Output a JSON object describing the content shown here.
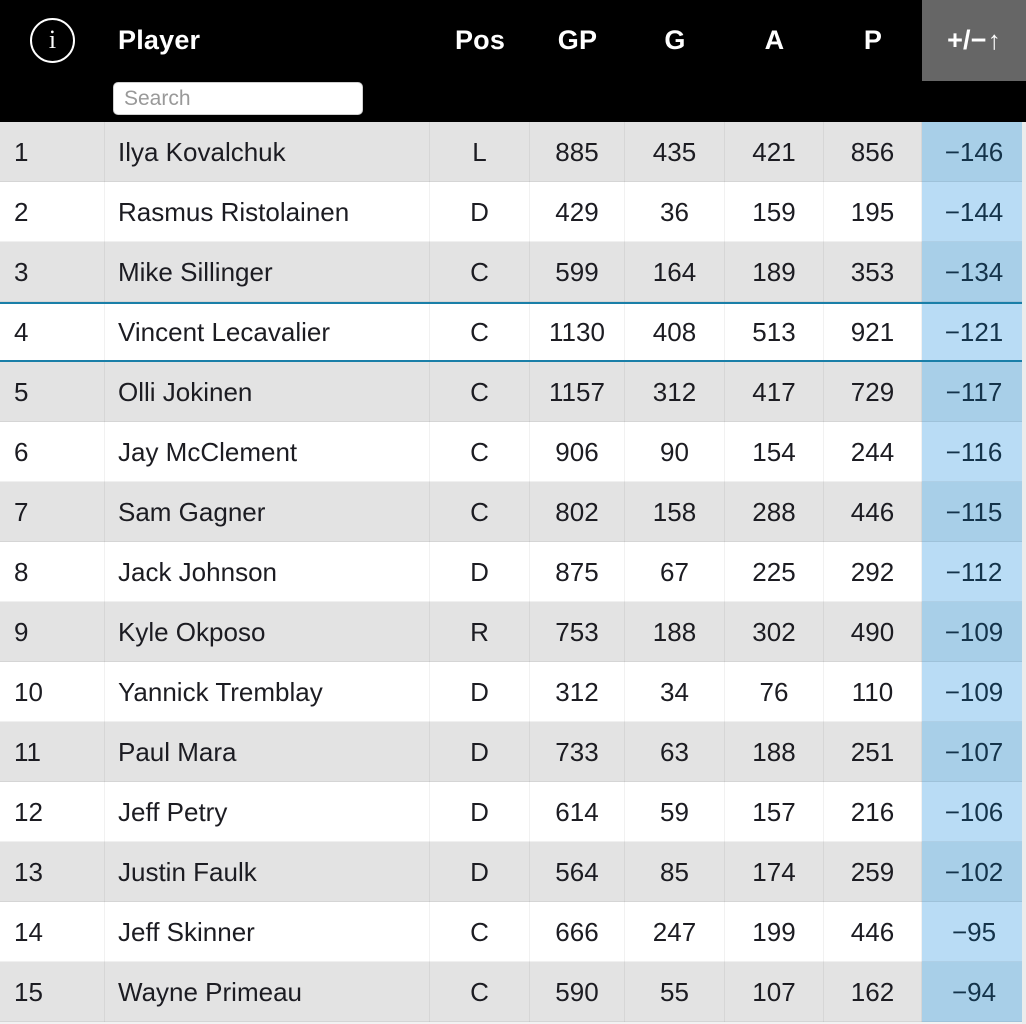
{
  "header": {
    "info_icon": "info-circle-icon",
    "info_glyph": "i",
    "columns": {
      "rank": "",
      "player": "Player",
      "pos": "Pos",
      "gp": "GP",
      "g": "G",
      "a": "A",
      "p": "P",
      "plusminus": "+/−",
      "sort_arrow": "↑"
    },
    "sorted_column": "plusminus",
    "sort_direction": "ascending"
  },
  "search": {
    "value": "",
    "placeholder": "Search"
  },
  "colors": {
    "header_bg": "#000000",
    "sorted_header_bg": "#666666",
    "row_odd_bg": "#e3e3e3",
    "row_even_bg": "#ffffff",
    "plusminus_odd_bg": "#a8cfe8",
    "plusminus_even_bg": "#b9dcf5",
    "highlight_border": "#1a7fa8",
    "text": "#1c1c22",
    "plusminus_text": "#14334a"
  },
  "table": {
    "columns": [
      "rank",
      "player",
      "pos",
      "gp",
      "g",
      "a",
      "p",
      "plusminus"
    ],
    "highlighted_row_rank": "4",
    "rows": [
      {
        "rank": "1",
        "player": "Ilya Kovalchuk",
        "pos": "L",
        "gp": "885",
        "g": "435",
        "a": "421",
        "p": "856",
        "plusminus": "−146",
        "highlighted": false
      },
      {
        "rank": "2",
        "player": "Rasmus Ristolainen",
        "pos": "D",
        "gp": "429",
        "g": "36",
        "a": "159",
        "p": "195",
        "plusminus": "−144",
        "highlighted": false
      },
      {
        "rank": "3",
        "player": "Mike Sillinger",
        "pos": "C",
        "gp": "599",
        "g": "164",
        "a": "189",
        "p": "353",
        "plusminus": "−134",
        "highlighted": false
      },
      {
        "rank": "4",
        "player": "Vincent Lecavalier",
        "pos": "C",
        "gp": "1130",
        "g": "408",
        "a": "513",
        "p": "921",
        "plusminus": "−121",
        "highlighted": true
      },
      {
        "rank": "5",
        "player": "Olli Jokinen",
        "pos": "C",
        "gp": "1157",
        "g": "312",
        "a": "417",
        "p": "729",
        "plusminus": "−117",
        "highlighted": false
      },
      {
        "rank": "6",
        "player": "Jay McClement",
        "pos": "C",
        "gp": "906",
        "g": "90",
        "a": "154",
        "p": "244",
        "plusminus": "−116",
        "highlighted": false
      },
      {
        "rank": "7",
        "player": "Sam Gagner",
        "pos": "C",
        "gp": "802",
        "g": "158",
        "a": "288",
        "p": "446",
        "plusminus": "−115",
        "highlighted": false
      },
      {
        "rank": "8",
        "player": "Jack Johnson",
        "pos": "D",
        "gp": "875",
        "g": "67",
        "a": "225",
        "p": "292",
        "plusminus": "−112",
        "highlighted": false
      },
      {
        "rank": "9",
        "player": "Kyle Okposo",
        "pos": "R",
        "gp": "753",
        "g": "188",
        "a": "302",
        "p": "490",
        "plusminus": "−109",
        "highlighted": false
      },
      {
        "rank": "10",
        "player": "Yannick Tremblay",
        "pos": "D",
        "gp": "312",
        "g": "34",
        "a": "76",
        "p": "110",
        "plusminus": "−109",
        "highlighted": false
      },
      {
        "rank": "11",
        "player": "Paul Mara",
        "pos": "D",
        "gp": "733",
        "g": "63",
        "a": "188",
        "p": "251",
        "plusminus": "−107",
        "highlighted": false
      },
      {
        "rank": "12",
        "player": "Jeff Petry",
        "pos": "D",
        "gp": "614",
        "g": "59",
        "a": "157",
        "p": "216",
        "plusminus": "−106",
        "highlighted": false
      },
      {
        "rank": "13",
        "player": "Justin Faulk",
        "pos": "D",
        "gp": "564",
        "g": "85",
        "a": "174",
        "p": "259",
        "plusminus": "−102",
        "highlighted": false
      },
      {
        "rank": "14",
        "player": "Jeff Skinner",
        "pos": "C",
        "gp": "666",
        "g": "247",
        "a": "199",
        "p": "446",
        "plusminus": "−95",
        "highlighted": false
      },
      {
        "rank": "15",
        "player": "Wayne Primeau",
        "pos": "C",
        "gp": "590",
        "g": "55",
        "a": "107",
        "p": "162",
        "plusminus": "−94",
        "highlighted": false
      }
    ]
  }
}
